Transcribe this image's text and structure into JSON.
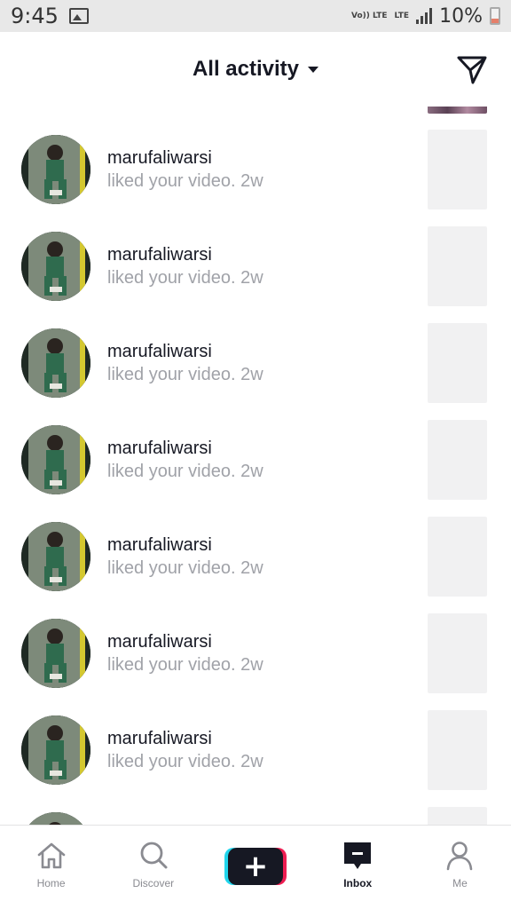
{
  "status_bar": {
    "time": "9:45",
    "volte_label": "Vo)) LTE",
    "lte_label": "LTE",
    "battery": "10%"
  },
  "header": {
    "title": "All activity",
    "send_icon": "send-icon"
  },
  "notifications": [
    {
      "username": "marufaliwarsi",
      "action": "liked your video. 2w"
    },
    {
      "username": "marufaliwarsi",
      "action": "liked your video. 2w"
    },
    {
      "username": "marufaliwarsi",
      "action": "liked your video. 2w"
    },
    {
      "username": "marufaliwarsi",
      "action": "liked your video. 2w"
    },
    {
      "username": "marufaliwarsi",
      "action": "liked your video. 2w"
    },
    {
      "username": "marufaliwarsi",
      "action": "liked your video. 2w"
    },
    {
      "username": "marufaliwarsi",
      "action": "liked your video. 2w"
    }
  ],
  "bottom_nav": {
    "home": "Home",
    "discover": "Discover",
    "create": "+",
    "inbox": "Inbox",
    "me": "Me"
  },
  "colors": {
    "accent_pink": "#ee1d52",
    "accent_cyan": "#20d5ec",
    "text_primary": "#161823",
    "text_secondary": "#a0a2a8"
  }
}
